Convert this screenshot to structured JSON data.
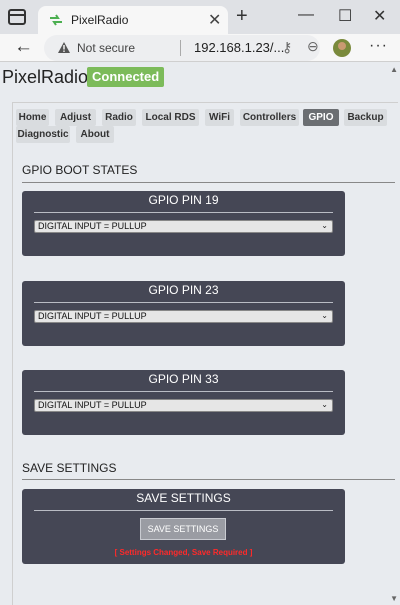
{
  "browser": {
    "tab_title": "PixelRadio",
    "security_label": "Not secure",
    "url": "192.168.1.23/..."
  },
  "page": {
    "brand": "PixelRadio",
    "status": "Connected",
    "nav_tabs": [
      {
        "label": "Home"
      },
      {
        "label": "Adjust"
      },
      {
        "label": "Radio"
      },
      {
        "label": "Local RDS"
      },
      {
        "label": "WiFi"
      },
      {
        "label": "Controllers"
      },
      {
        "label": "GPIO"
      },
      {
        "label": "Backup"
      },
      {
        "label": "Diagnostic"
      },
      {
        "label": "About"
      }
    ],
    "active_tab": "GPIO",
    "gpio_section_title": "GPIO BOOT STATES",
    "gpio_cards": [
      {
        "title": "GPIO PIN 19",
        "value": "DIGITAL INPUT = PULLUP"
      },
      {
        "title": "GPIO PIN 23",
        "value": "DIGITAL INPUT = PULLUP"
      },
      {
        "title": "GPIO PIN 33",
        "value": "DIGITAL INPUT = PULLUP"
      }
    ],
    "save_section_title": "SAVE SETTINGS",
    "save_card": {
      "title": "SAVE SETTINGS",
      "button_label": "SAVE SETTINGS",
      "warning": "[ Settings Changed, Save Required ]"
    }
  },
  "colors": {
    "status_green": "#7cbb5a",
    "card_bg": "#454755",
    "active_tab": "#6b6e72",
    "warning_red": "#ff2a2a"
  }
}
